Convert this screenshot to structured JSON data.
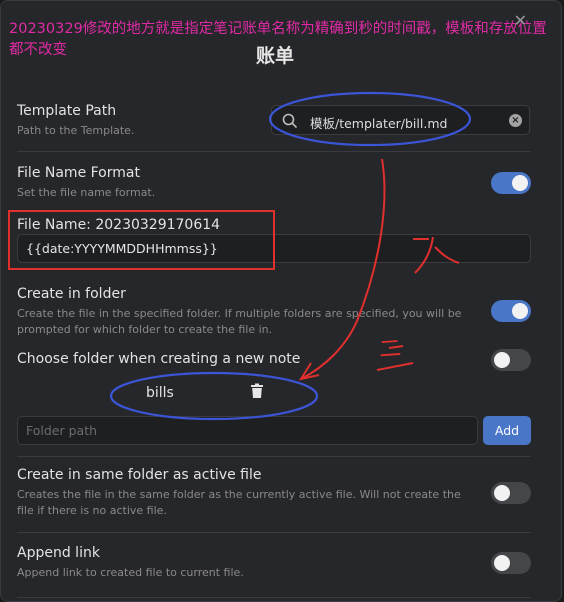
{
  "annotation": {
    "text": "20230329修改的地方就是指定笔记账单名称为精确到秒的时间戳，模板和存放位置都不改变",
    "handwritten_mark": "二",
    "color": "#e02aa5"
  },
  "modal": {
    "title": "账单",
    "close_icon": "close-icon"
  },
  "settings": {
    "template_path": {
      "name": "Template Path",
      "desc": "Path to the Template.",
      "value": "模板/templater/bill.md"
    },
    "file_name_format": {
      "name": "File Name Format",
      "desc": "Set the file name format.",
      "enabled": true
    },
    "file_name": {
      "label": "File Name: 20230329170614",
      "value": "{{date:YYYYMMDDHHmmss}}"
    },
    "create_in_folder": {
      "name": "Create in folder",
      "desc": "Create the file in the specified folder. If multiple folders are specified, you will be prompted for which folder to create the file in.",
      "enabled": true
    },
    "choose_folder": {
      "name": "Choose folder when creating a new note",
      "enabled": false
    },
    "folders": [
      "bills"
    ],
    "folder_input": {
      "placeholder": "Folder path",
      "add_label": "Add"
    },
    "same_folder": {
      "name": "Create in same folder as active file",
      "desc": "Creates the file in the same folder as the currently active file. Will not create the file if there is no active file.",
      "enabled": false
    },
    "append_link": {
      "name": "Append link",
      "desc": "Append link to created file to current file.",
      "enabled": false
    }
  },
  "colors": {
    "accent": "#4a76c8",
    "annotation_red": "#e0302e",
    "annotation_blue": "#3b55d6",
    "background": "#26272a"
  }
}
